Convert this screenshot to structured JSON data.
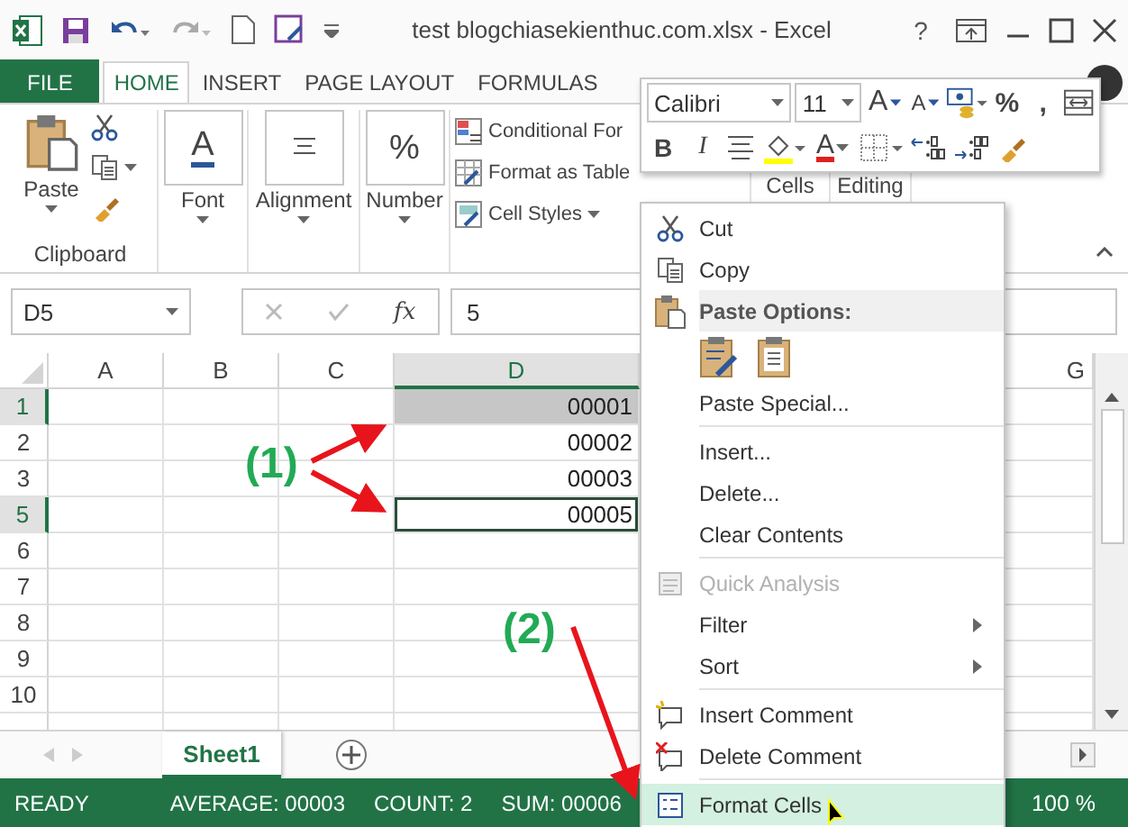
{
  "window": {
    "title": "test blogchiasekienthuc.com.xlsx - Excel",
    "help_label": "?"
  },
  "ribbon_tabs": [
    {
      "label": "FILE",
      "kind": "backstage",
      "selected": false
    },
    {
      "label": "HOME",
      "kind": "tab",
      "selected": true
    },
    {
      "label": "INSERT",
      "kind": "tab",
      "selected": false
    },
    {
      "label": "PAGE LAYOUT",
      "kind": "tab",
      "selected": false
    },
    {
      "label": "FORMULAS",
      "kind": "tab",
      "selected": false
    }
  ],
  "ribbon": {
    "paste_label": "Paste",
    "clipboard_label": "Clipboard",
    "big_buttons": [
      {
        "label": "Font",
        "kind": "font",
        "icon_text": "A"
      },
      {
        "label": "Alignment",
        "kind": "align"
      },
      {
        "label": "Number",
        "kind": "number",
        "icon_text": "%"
      }
    ],
    "styles": [
      {
        "label": "Conditional For",
        "kind": "conditional",
        "dropdown": false
      },
      {
        "label": "Format as Table",
        "kind": "table",
        "dropdown": false
      },
      {
        "label": "Cell Styles",
        "kind": "cellstyles",
        "dropdown": true
      }
    ],
    "collapsed_groups": [
      "Cells",
      "Editing"
    ]
  },
  "mini_toolbar": {
    "font": "Calibri",
    "size": "11",
    "row1": [
      {
        "kind": "grow",
        "label": "A"
      },
      {
        "kind": "shrink",
        "label": "A"
      },
      {
        "kind": "accounting"
      },
      {
        "kind": "char",
        "label": "%"
      },
      {
        "kind": "char",
        "label": ","
      },
      {
        "kind": "wrap"
      }
    ],
    "row2": [
      {
        "kind": "bold",
        "label": "B"
      },
      {
        "kind": "italic",
        "label": "I"
      },
      {
        "kind": "center"
      },
      {
        "kind": "fill"
      },
      {
        "kind": "fontcolor",
        "label": "A"
      },
      {
        "kind": "borders"
      },
      {
        "kind": "incdec"
      },
      {
        "kind": "decdec"
      },
      {
        "kind": "painter"
      }
    ]
  },
  "formula_bar": {
    "name_box": "D5",
    "function_label": "fx",
    "value": "5"
  },
  "sheet": {
    "columns": [
      {
        "label": "A",
        "selected": false
      },
      {
        "label": "B",
        "selected": false
      },
      {
        "label": "C",
        "selected": false
      },
      {
        "label": "D",
        "selected": true
      }
    ],
    "far_column": "G",
    "rows": [
      {
        "header": "1",
        "selected": true,
        "active": false,
        "value": "00001"
      },
      {
        "header": "2",
        "selected": false,
        "active": false,
        "value": "00002"
      },
      {
        "header": "3",
        "selected": false,
        "active": false,
        "value": "00003"
      },
      {
        "header": "5",
        "selected": true,
        "active": true,
        "value": "00005"
      },
      {
        "header": "6",
        "selected": false,
        "active": false
      },
      {
        "header": "7",
        "selected": false,
        "active": false
      },
      {
        "header": "8",
        "selected": false,
        "active": false
      },
      {
        "header": "9",
        "selected": false,
        "active": false
      },
      {
        "header": "10",
        "selected": false,
        "active": false
      }
    ]
  },
  "sheet_tabs": [
    {
      "label": "Sheet1",
      "selected": true
    }
  ],
  "status_bar": {
    "mode": "READY",
    "stats": [
      "AVERAGE: 00003",
      "COUNT: 2",
      "SUM: 00006"
    ],
    "zoom": "100 %"
  },
  "context_menu": {
    "items": [
      {
        "kind": "item",
        "label": "Cut",
        "selected": false,
        "disabled": false,
        "submenu": false
      },
      {
        "kind": "item",
        "label": "Copy",
        "selected": false,
        "disabled": false,
        "submenu": false
      },
      {
        "kind": "header",
        "label": "Paste Options:"
      },
      {
        "kind": "paste_icons"
      },
      {
        "kind": "item",
        "label": "Paste Special...",
        "selected": false,
        "disabled": false,
        "submenu": false
      },
      {
        "kind": "separator"
      },
      {
        "kind": "item",
        "label": "Insert...",
        "selected": false,
        "disabled": false,
        "submenu": false
      },
      {
        "kind": "item",
        "label": "Delete...",
        "selected": false,
        "disabled": false,
        "submenu": false
      },
      {
        "kind": "item",
        "label": "Clear Contents",
        "selected": false,
        "disabled": false,
        "submenu": false
      },
      {
        "kind": "separator"
      },
      {
        "kind": "item",
        "label": "Quick Analysis",
        "selected": false,
        "disabled": true,
        "submenu": false
      },
      {
        "kind": "item",
        "label": "Filter",
        "selected": false,
        "disabled": false,
        "submenu": true
      },
      {
        "kind": "item",
        "label": "Sort",
        "selected": false,
        "disabled": false,
        "submenu": true
      },
      {
        "kind": "separator"
      },
      {
        "kind": "item",
        "label": "Insert Comment",
        "selected": false,
        "disabled": false,
        "submenu": false
      },
      {
        "kind": "item",
        "label": "Delete Comment",
        "selected": false,
        "disabled": false,
        "submenu": false
      },
      {
        "kind": "separator"
      },
      {
        "kind": "item",
        "label": "Format Cells",
        "selected": true,
        "disabled": false,
        "submenu": false
      }
    ]
  },
  "annotations": [
    {
      "label": "(1)"
    },
    {
      "label": "(2)"
    }
  ]
}
